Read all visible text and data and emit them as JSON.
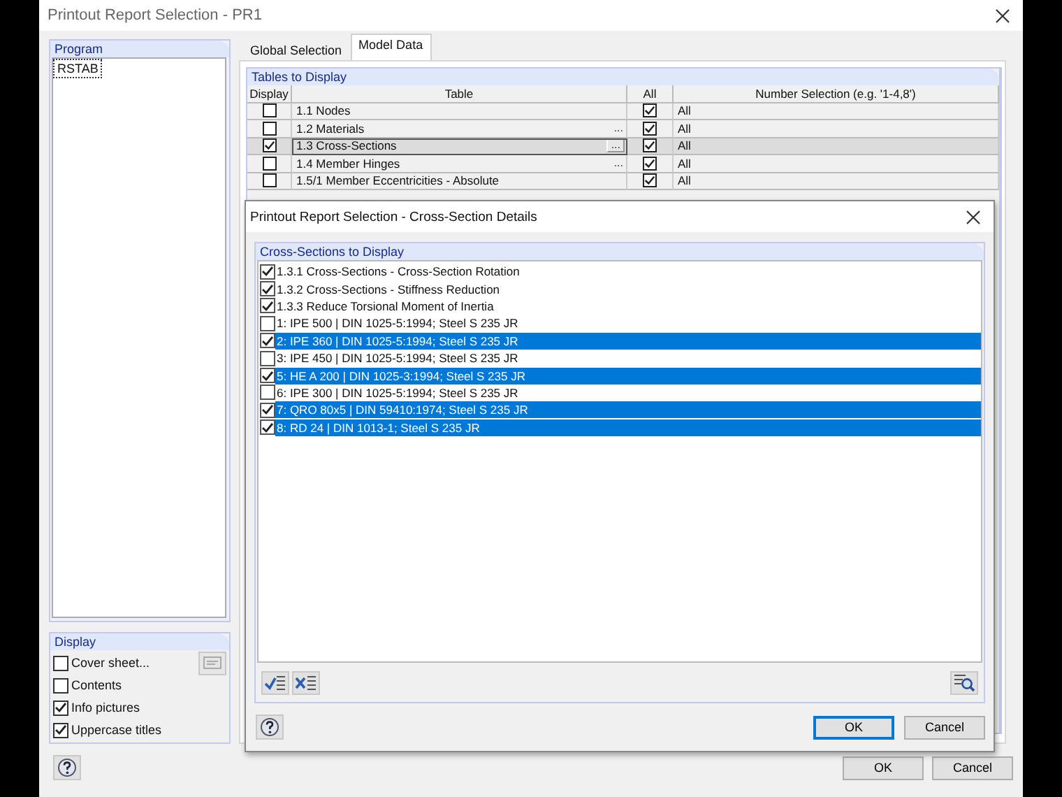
{
  "window": {
    "title": "Printout Report Selection - PR1"
  },
  "program_panel": {
    "title": "Program",
    "items": [
      {
        "label": "RSTAB",
        "selected": true
      }
    ]
  },
  "display_panel": {
    "title": "Display",
    "options": [
      {
        "label": "Cover sheet...",
        "checked": false
      },
      {
        "label": "Contents",
        "checked": false
      },
      {
        "label": "Info pictures",
        "checked": true
      },
      {
        "label": "Uppercase titles",
        "checked": true
      }
    ]
  },
  "tabs": [
    {
      "label": "Global Selection",
      "selected": false
    },
    {
      "label": "Model Data",
      "selected": true
    }
  ],
  "tables_panel": {
    "title": "Tables to Display",
    "columns": [
      "Display",
      "Table",
      "All",
      "Number Selection (e.g. '1-4,8')"
    ],
    "rows": [
      {
        "display": false,
        "table": "1.1 Nodes",
        "details": "",
        "all": true,
        "number_selection": "All",
        "selected": false
      },
      {
        "display": false,
        "table": "1.2 Materials",
        "details": "...",
        "all": true,
        "number_selection": "All",
        "selected": false
      },
      {
        "display": true,
        "table": "1.3 Cross-Sections",
        "details": "...",
        "all": true,
        "number_selection": "All",
        "selected": true
      },
      {
        "display": false,
        "table": "1.4 Member Hinges",
        "details": "...",
        "all": true,
        "number_selection": "All",
        "selected": false
      },
      {
        "display": false,
        "table": "1.5/1 Member Eccentricities - Absolute",
        "details": "",
        "all": true,
        "number_selection": "All",
        "selected": false
      }
    ]
  },
  "buttons": [
    "OK",
    "Cancel"
  ],
  "dialog": {
    "title": "Printout Report Selection - Cross-Section Details",
    "panel_title": "Cross-Sections to Display",
    "items": [
      {
        "label": "1.3.1 Cross-Sections - Cross-Section Rotation",
        "checked": true,
        "selected": false
      },
      {
        "label": "1.3.2 Cross-Sections - Stiffness Reduction",
        "checked": true,
        "selected": false
      },
      {
        "label": "1.3.3 Reduce Torsional Moment of Inertia",
        "checked": true,
        "selected": false
      },
      {
        "label": "1: IPE 500 | DIN 1025-5:1994; Steel S 235 JR",
        "checked": false,
        "selected": false
      },
      {
        "label": "2: IPE 360 | DIN 1025-5:1994; Steel S 235 JR",
        "checked": true,
        "selected": true
      },
      {
        "label": "3: IPE 450 | DIN 1025-5:1994; Steel S 235 JR",
        "checked": false,
        "selected": false
      },
      {
        "label": "5: HE A 200 | DIN 1025-3:1994; Steel S 235 JR",
        "checked": true,
        "selected": true
      },
      {
        "label": "6: IPE 300 | DIN 1025-5:1994; Steel S 235 JR",
        "checked": false,
        "selected": false
      },
      {
        "label": "7: QRO 80x5 | DIN 59410:1974; Steel S 235 JR",
        "checked": true,
        "selected": true
      },
      {
        "label": "8: RD 24 | DIN 1013-1; Steel S 235 JR",
        "checked": true,
        "selected": true
      }
    ],
    "buttons": [
      "OK",
      "Cancel"
    ]
  }
}
